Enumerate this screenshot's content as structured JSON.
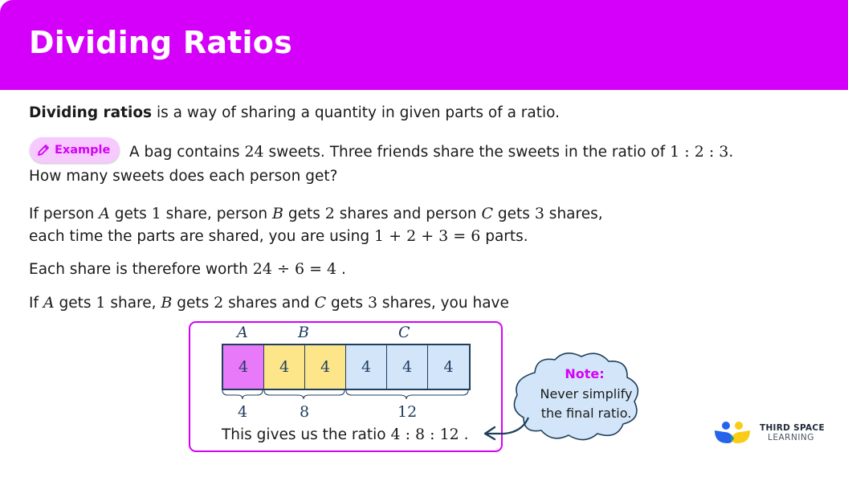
{
  "header": {
    "title": "Dividing Ratios",
    "color": "#d500f9"
  },
  "definition": {
    "term": "Dividing ratios",
    "rest": " is a way of sharing a quantity in given parts of a ratio."
  },
  "example": {
    "badge_label": "Example",
    "badge_icon": "pencil-icon",
    "line1_a": "A bag contains ",
    "line1_num": "24",
    "line1_b": " sweets. Three friends share the sweets in the ratio of ",
    "line1_ratio": "1 : 2 : 3",
    "line1_end": ".",
    "line2": "How many sweets does each person get?"
  },
  "explanation": {
    "p1_line1": [
      "If person ",
      "A",
      " gets ",
      "1",
      " share, person ",
      "B",
      " gets ",
      "2",
      " shares and person ",
      "C",
      " gets ",
      "3",
      " shares,"
    ],
    "p1_line2_a": "each time the parts are shared, you are using ",
    "p1_line2_math": "1 + 2 + 3 = 6",
    "p1_line2_b": " parts.",
    "p2_a": "Each share is therefore worth ",
    "p2_math": "24 ÷ 6 = 4",
    "p2_b": " .",
    "p3": [
      "If ",
      "A",
      " gets ",
      "1",
      " share, ",
      "B",
      " gets ",
      "2",
      " shares and ",
      "C",
      " gets ",
      "3",
      " shares, you have"
    ]
  },
  "diagram": {
    "labels": [
      "A",
      "B",
      "C"
    ],
    "cells": [
      {
        "value": "4",
        "person": "A"
      },
      {
        "value": "4",
        "person": "B"
      },
      {
        "value": "4",
        "person": "B"
      },
      {
        "value": "4",
        "person": "C"
      },
      {
        "value": "4",
        "person": "C"
      },
      {
        "value": "4",
        "person": "C"
      }
    ],
    "totals": [
      "4",
      "8",
      "12"
    ],
    "colors": {
      "A": "#e879f9",
      "B": "#fde68a",
      "C": "#d3e6f9"
    },
    "result_text": "This gives us the ratio ",
    "result_ratio": "4 : 8 : 12",
    "result_end": " ."
  },
  "note": {
    "title": "Note:",
    "line1": "Never simplify",
    "line2": "the final ratio."
  },
  "logo": {
    "line1": "THIRD SPACE",
    "line2": "LEARNING"
  }
}
